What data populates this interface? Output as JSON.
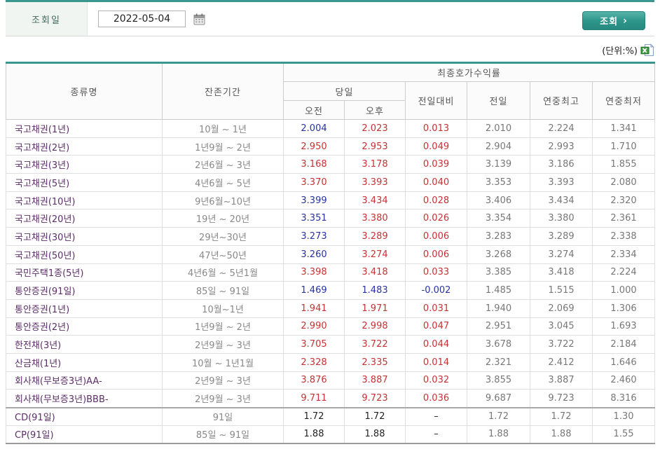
{
  "toolbar": {
    "date_label": "조회일",
    "date_value": "2022-05-04",
    "search_button": "조회",
    "search_arrow": "›"
  },
  "unit_label": "(단위:%)",
  "table": {
    "headers": {
      "col_type": "종류명",
      "col_period": "잔존기간",
      "group_yield": "최종호가수익률",
      "group_today": "당일",
      "col_am": "오전",
      "col_pm": "오후",
      "col_change": "전일대비",
      "col_prev": "전일",
      "col_high": "연중최고",
      "col_low": "연중최저"
    },
    "rows": [
      {
        "name": "국고채권(1년)",
        "period": "10월 ~ 1년",
        "am": "2.004",
        "pm": "2.023",
        "change": "0.013",
        "prev": "2.010",
        "high": "2.224",
        "low": "1.341",
        "am_c": "down",
        "pm_c": "up",
        "chg_c": "up",
        "sep": false
      },
      {
        "name": "국고채권(2년)",
        "period": "1년9월 ~ 2년",
        "am": "2.950",
        "pm": "2.953",
        "change": "0.049",
        "prev": "2.904",
        "high": "2.993",
        "low": "1.710",
        "am_c": "up",
        "pm_c": "up",
        "chg_c": "up",
        "sep": false
      },
      {
        "name": "국고채권(3년)",
        "period": "2년6월 ~ 3년",
        "am": "3.168",
        "pm": "3.178",
        "change": "0.039",
        "prev": "3.139",
        "high": "3.186",
        "low": "1.855",
        "am_c": "up",
        "pm_c": "up",
        "chg_c": "up",
        "sep": false
      },
      {
        "name": "국고채권(5년)",
        "period": "4년6월 ~ 5년",
        "am": "3.370",
        "pm": "3.393",
        "change": "0.040",
        "prev": "3.353",
        "high": "3.393",
        "low": "2.080",
        "am_c": "up",
        "pm_c": "up",
        "chg_c": "up",
        "sep": false
      },
      {
        "name": "국고채권(10년)",
        "period": "9년6월~10년",
        "am": "3.399",
        "pm": "3.434",
        "change": "0.028",
        "prev": "3.406",
        "high": "3.434",
        "low": "2.320",
        "am_c": "down",
        "pm_c": "up",
        "chg_c": "up",
        "sep": false
      },
      {
        "name": "국고채권(20년)",
        "period": "19년 ~ 20년",
        "am": "3.351",
        "pm": "3.380",
        "change": "0.026",
        "prev": "3.354",
        "high": "3.380",
        "low": "2.361",
        "am_c": "down",
        "pm_c": "up",
        "chg_c": "up",
        "sep": false
      },
      {
        "name": "국고채권(30년)",
        "period": "29년~30년",
        "am": "3.273",
        "pm": "3.289",
        "change": "0.006",
        "prev": "3.283",
        "high": "3.289",
        "low": "2.338",
        "am_c": "down",
        "pm_c": "up",
        "chg_c": "up",
        "sep": false
      },
      {
        "name": "국고채권(50년)",
        "period": "47년~50년",
        "am": "3.260",
        "pm": "3.274",
        "change": "0.006",
        "prev": "3.268",
        "high": "3.274",
        "low": "2.334",
        "am_c": "down",
        "pm_c": "up",
        "chg_c": "up",
        "sep": false
      },
      {
        "name": "국민주택1종(5년)",
        "period": "4년6월 ~ 5년1월",
        "am": "3.398",
        "pm": "3.418",
        "change": "0.033",
        "prev": "3.385",
        "high": "3.418",
        "low": "2.224",
        "am_c": "up",
        "pm_c": "up",
        "chg_c": "up",
        "sep": false
      },
      {
        "name": "통안증권(91일)",
        "period": "85일 ~ 91일",
        "am": "1.469",
        "pm": "1.483",
        "change": "-0.002",
        "prev": "1.485",
        "high": "1.515",
        "low": "1.000",
        "am_c": "down",
        "pm_c": "down",
        "chg_c": "down",
        "sep": false
      },
      {
        "name": "통안증권(1년)",
        "period": "10월~1년",
        "am": "1.941",
        "pm": "1.971",
        "change": "0.031",
        "prev": "1.940",
        "high": "2.069",
        "low": "1.306",
        "am_c": "up",
        "pm_c": "up",
        "chg_c": "up",
        "sep": false
      },
      {
        "name": "통안증권(2년)",
        "period": "1년9월 ~ 2년",
        "am": "2.990",
        "pm": "2.998",
        "change": "0.047",
        "prev": "2.951",
        "high": "3.045",
        "low": "1.693",
        "am_c": "up",
        "pm_c": "up",
        "chg_c": "up",
        "sep": false
      },
      {
        "name": "한전채(3년)",
        "period": "2년9월 ~ 3년",
        "am": "3.705",
        "pm": "3.722",
        "change": "0.044",
        "prev": "3.678",
        "high": "3.722",
        "low": "2.184",
        "am_c": "up",
        "pm_c": "up",
        "chg_c": "up",
        "sep": false
      },
      {
        "name": "산금채(1년)",
        "period": "10월 ~ 1년1월",
        "am": "2.328",
        "pm": "2.335",
        "change": "0.014",
        "prev": "2.321",
        "high": "2.412",
        "low": "1.646",
        "am_c": "up",
        "pm_c": "up",
        "chg_c": "up",
        "sep": false
      },
      {
        "name": "회사채(무보증3년)AA-",
        "period": "2년9월 ~ 3년",
        "am": "3.876",
        "pm": "3.887",
        "change": "0.032",
        "prev": "3.855",
        "high": "3.887",
        "low": "2.460",
        "am_c": "up",
        "pm_c": "up",
        "chg_c": "up",
        "sep": false
      },
      {
        "name": "회사채(무보증3년)BBB-",
        "period": "2년9월 ~ 3년",
        "am": "9.711",
        "pm": "9.723",
        "change": "0.036",
        "prev": "9.687",
        "high": "9.723",
        "low": "8.316",
        "am_c": "up",
        "pm_c": "up",
        "chg_c": "up",
        "sep": false
      },
      {
        "name": "CD(91일)",
        "period": "91일",
        "am": "1.72",
        "pm": "1.72",
        "change": "–",
        "prev": "1.72",
        "high": "1.72",
        "low": "1.30",
        "am_c": "flat",
        "pm_c": "flat",
        "chg_c": "flat",
        "sep": true
      },
      {
        "name": "CP(91일)",
        "period": "85일 ~ 91일",
        "am": "1.88",
        "pm": "1.88",
        "change": "–",
        "prev": "1.88",
        "high": "1.88",
        "low": "1.55",
        "am_c": "flat",
        "pm_c": "flat",
        "chg_c": "flat",
        "sep": false
      }
    ]
  },
  "colors": {
    "accent_teal": "#3a978d",
    "up_red": "#c63232",
    "down_blue": "#2733a0",
    "name_purple": "#5c2e68",
    "muted_gray": "#777777"
  }
}
